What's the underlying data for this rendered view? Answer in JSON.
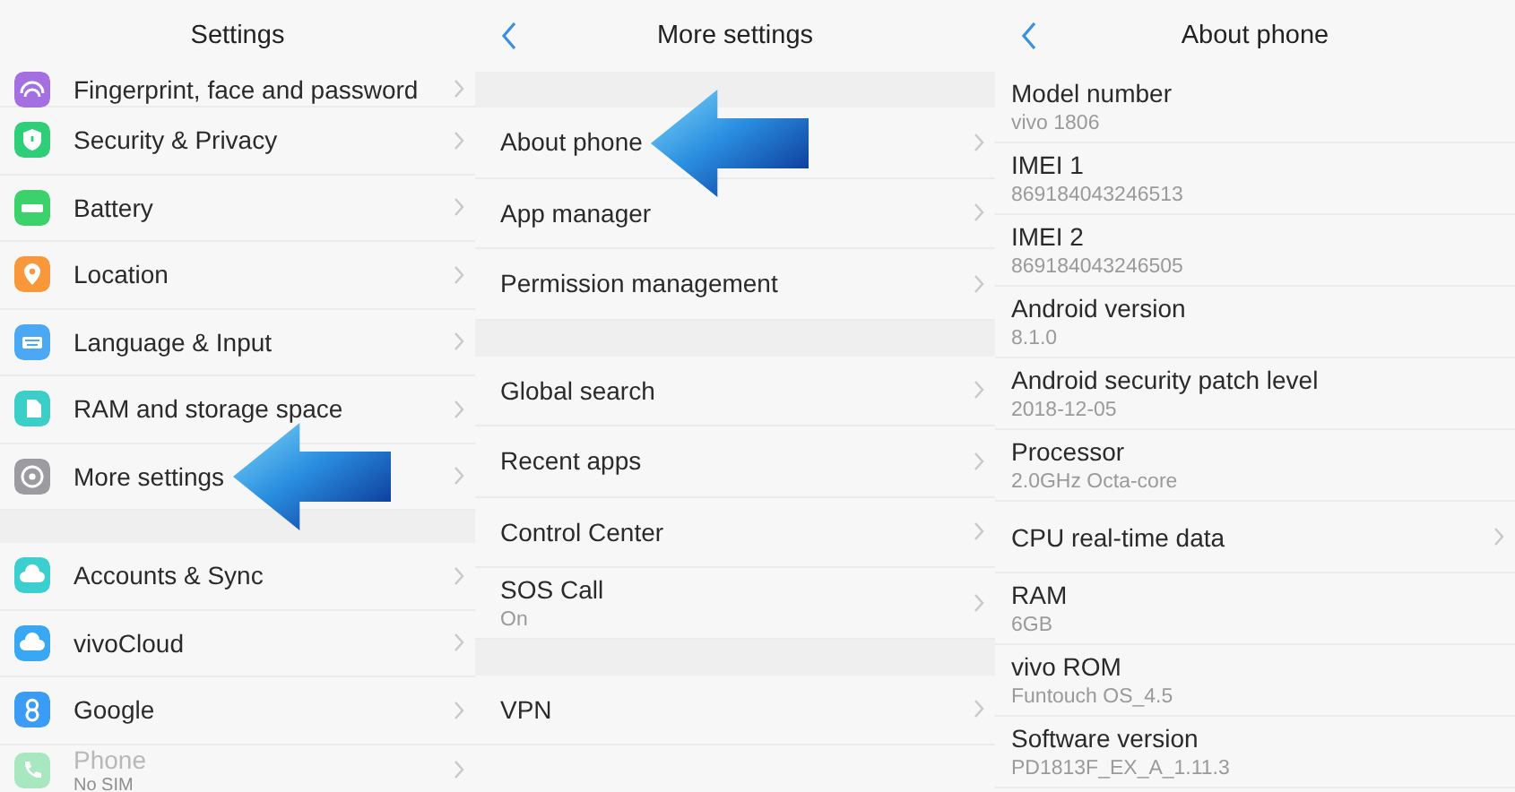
{
  "screens": [
    {
      "title": "Settings",
      "back_button": false,
      "groups": [
        {
          "items": [
            {
              "kind": "link",
              "label": "Fingerprint, face and password",
              "color": "#a46fe0",
              "disabled": false,
              "pointer": false
            },
            {
              "kind": "link",
              "label": "Security & Privacy",
              "color": "#2fcf7a",
              "disabled": false,
              "pointer": false
            },
            {
              "kind": "link",
              "label": "Battery",
              "color": "#3bd26c",
              "disabled": false,
              "pointer": false
            },
            {
              "kind": "link",
              "label": "Location",
              "color": "#f8983a",
              "disabled": false,
              "pointer": false
            },
            {
              "kind": "link",
              "label": "Language & Input",
              "color": "#4aa8f5",
              "disabled": false,
              "pointer": false
            },
            {
              "kind": "link",
              "label": "RAM and storage space",
              "color": "#3ccfc8",
              "disabled": false,
              "pointer": false
            },
            {
              "kind": "link",
              "label": "More settings",
              "color": "#9b9ba0",
              "disabled": false,
              "pointer": true
            }
          ]
        },
        {
          "items": [
            {
              "kind": "link",
              "label": "Accounts & Sync",
              "color": "#3ccfd0",
              "disabled": false,
              "pointer": false
            },
            {
              "kind": "link",
              "label": "vivoCloud",
              "color": "#38a8f5",
              "disabled": false,
              "pointer": false
            },
            {
              "kind": "link",
              "label": "Google",
              "color": "#3a9cf5",
              "disabled": false,
              "pointer": false
            },
            {
              "kind": "link",
              "label": "Phone",
              "subtitle": "No SIM",
              "color": "#a8e8c0",
              "disabled": true,
              "pointer": false
            }
          ]
        }
      ]
    },
    {
      "title": "More settings",
      "back_button": true,
      "groups": [
        {
          "items": [
            {
              "kind": "link",
              "label": "About phone",
              "pointer": true
            },
            {
              "kind": "link",
              "label": "App manager",
              "pointer": false
            },
            {
              "kind": "link",
              "label": "Permission management",
              "pointer": false
            }
          ]
        },
        {
          "items": [
            {
              "kind": "link",
              "label": "Global search",
              "pointer": false
            },
            {
              "kind": "link",
              "label": "Recent apps",
              "pointer": false
            },
            {
              "kind": "link",
              "label": "Control Center",
              "pointer": false
            },
            {
              "kind": "link",
              "label": "SOS Call",
              "subtitle": "On",
              "pointer": false
            }
          ]
        },
        {
          "items": [
            {
              "kind": "link",
              "label": "VPN",
              "pointer": false
            }
          ]
        }
      ]
    },
    {
      "title": "About phone",
      "back_button": true,
      "groups": [
        {
          "items": [
            {
              "kind": "info",
              "label": "Model number",
              "subtitle": "vivo 1806"
            },
            {
              "kind": "info",
              "label": "IMEI 1",
              "subtitle": "869184043246513"
            },
            {
              "kind": "info",
              "label": "IMEI 2",
              "subtitle": "869184043246505"
            },
            {
              "kind": "info",
              "label": "Android version",
              "subtitle": "8.1.0"
            },
            {
              "kind": "info",
              "label": "Android security patch level",
              "subtitle": "2018-12-05"
            },
            {
              "kind": "info",
              "label": "Processor",
              "subtitle": "2.0GHz Octa-core"
            },
            {
              "kind": "link",
              "label": "CPU real-time data"
            },
            {
              "kind": "info",
              "label": "RAM",
              "subtitle": "6GB"
            },
            {
              "kind": "info",
              "label": "vivo ROM",
              "subtitle": "Funtouch OS_4.5"
            },
            {
              "kind": "info",
              "label": "Software version",
              "subtitle": "PD1813F_EX_A_1.11.3"
            }
          ]
        }
      ]
    }
  ]
}
